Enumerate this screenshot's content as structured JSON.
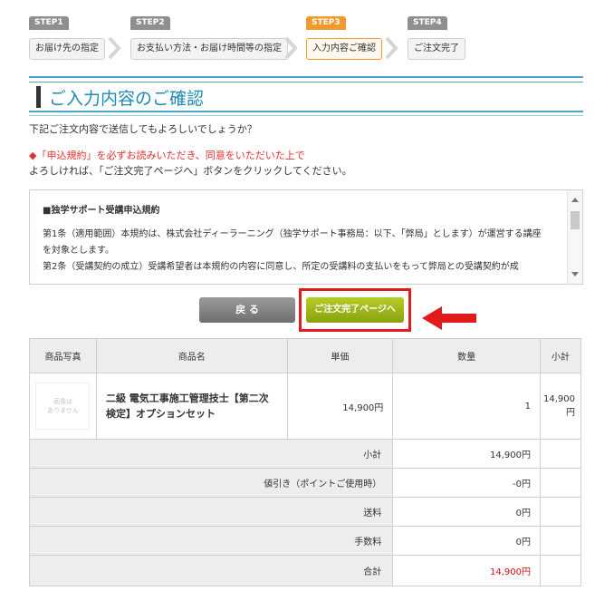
{
  "steps": [
    {
      "badge": "STEP1",
      "label": "お届け先の指定"
    },
    {
      "badge": "STEP2",
      "label": "お支払い方法・お届け時間等の指定"
    },
    {
      "badge": "STEP3",
      "label": "入力内容ご確認"
    },
    {
      "badge": "STEP4",
      "label": "ご注文完了"
    }
  ],
  "page": {
    "title": "ご入力内容のご確認",
    "intro": "下記ご注文内容で送信してもよろしいでしょうか？",
    "notice_red": "◆「申込規約」を必ずお読みいただき、同意をいただいた上で",
    "notice_body": "よろしければ、「ご注文完了ページへ」ボタンをクリックしてください。"
  },
  "terms": {
    "heading": "■独学サポート受講申込規約",
    "line1": "第1条（適用範囲）本規約は、株式会社ディーラーニング（独学サポート事務局：以下、「弊局」とします）が運営する講座",
    "line2": "を対象とします。",
    "line3": "第2条（受講契約の成立）受講希望者は本規約の内容に同意し、所定の受講料の支払いをもって弊局との受講契約が成"
  },
  "buttons": {
    "back": "戻 る",
    "next": "ご注文完了ページへ"
  },
  "cart": {
    "headers": [
      "商品写真",
      "商品名",
      "単価",
      "数量",
      "小計"
    ],
    "item": {
      "no_image": "画像は\nありません",
      "name": "二級 電気工事施工管理技士【第二次検定】オプションセット",
      "price": "14,900円",
      "qty": "1",
      "subtotal": "14,900円"
    },
    "summary": [
      {
        "label": "小計",
        "value": "14,900円"
      },
      {
        "label": "値引き（ポイントご使用時）",
        "value": "-0円"
      },
      {
        "label": "送料",
        "value": "0円"
      },
      {
        "label": "手数料",
        "value": "0円"
      },
      {
        "label": "合計",
        "value": "14,900円"
      }
    ]
  },
  "colors": {
    "accent_blue": "#1d8bb4",
    "step_active": "#f29a2e",
    "highlight_red": "#e11b1b",
    "next_button": "#9cb41a",
    "total_red": "#d01010"
  }
}
